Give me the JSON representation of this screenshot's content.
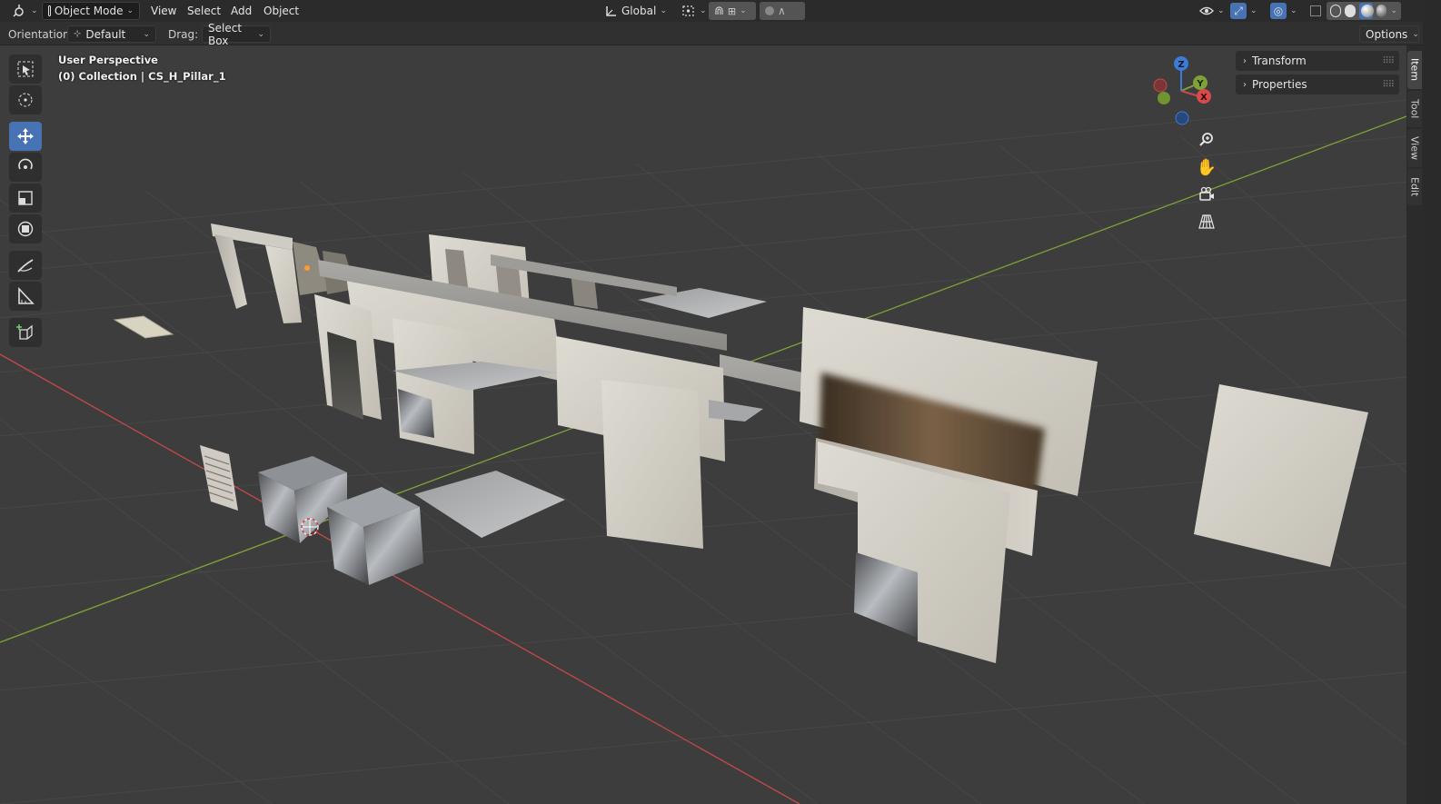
{
  "header": {
    "mode": "Object Mode",
    "menus": [
      "View",
      "Select",
      "Add",
      "Object"
    ],
    "transform_orientation": "Global"
  },
  "tool_settings": {
    "orientation_label": "Orientation:",
    "orientation_value": "Default",
    "drag_label": "Drag:",
    "drag_value": "Select Box",
    "options_label": "Options"
  },
  "viewport": {
    "perspective": "User Perspective",
    "collection_info": "(0) Collection | CS_H_Pillar_1"
  },
  "gizmo": {
    "z": "Z",
    "y": "Y",
    "x": "X"
  },
  "sidebar": {
    "panels": [
      "Transform",
      "Properties"
    ],
    "tabs": [
      "Item",
      "Tool",
      "View",
      "Edit"
    ],
    "active_tab": "Item"
  },
  "colors": {
    "accent": "#4772b3",
    "x_axis": "#c94848",
    "y_axis": "#7ea238",
    "z_axis": "#3f7bd4"
  }
}
